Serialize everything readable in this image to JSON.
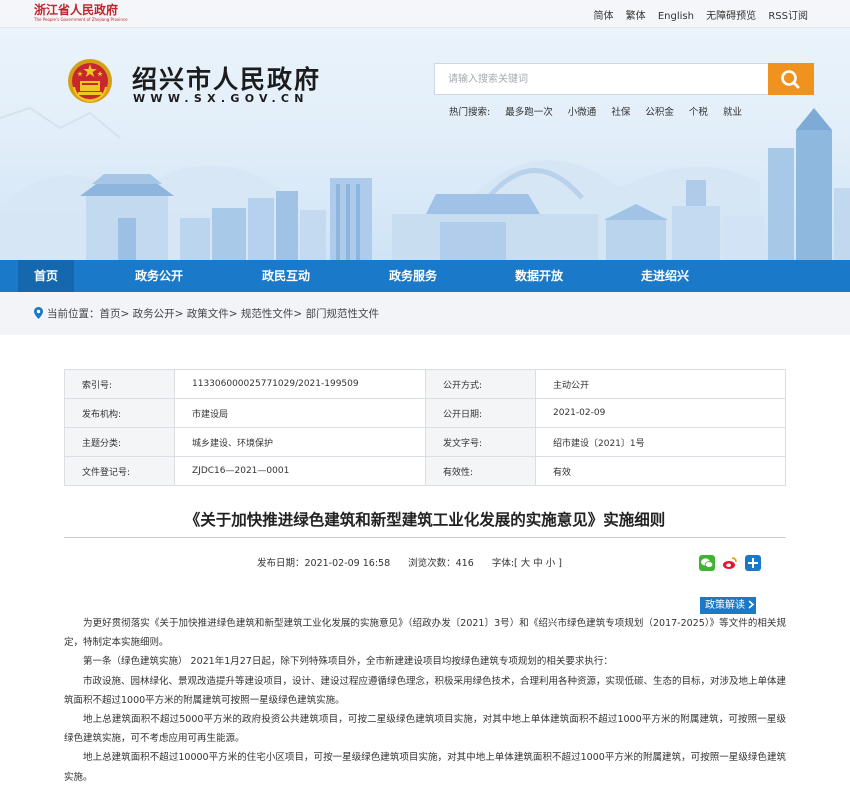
{
  "topbar": {
    "province_cn": "浙江省人民政府",
    "province_en": "The People's Government of Zhejiang Province",
    "links": [
      "简体",
      "繁体",
      "English",
      "无障碍预览",
      "RSS订阅"
    ]
  },
  "header": {
    "site_name": "绍兴市人民政府",
    "site_url": "WWW.SX.GOV.CN",
    "search_placeholder": "请输入搜索关键词",
    "hot_label": "热门搜索:",
    "hot_terms": [
      "最多跑一次",
      "小微通",
      "社保",
      "公积金",
      "个税",
      "就业"
    ]
  },
  "nav": [
    "首页",
    "政务公开",
    "政民互动",
    "政务服务",
    "数据开放",
    "走进绍兴"
  ],
  "breadcrumb": {
    "label": "当前位置：",
    "items": [
      "首页",
      "政务公开",
      "政策文件",
      "规范性文件",
      "部门规范性文件"
    ]
  },
  "info_table": [
    [
      "索引号:",
      "113306000025771029/2021-199509",
      "公开方式:",
      "主动公开"
    ],
    [
      "发布机构:",
      "市建设局",
      "公开日期:",
      "2021-02-09"
    ],
    [
      "主题分类:",
      "城乡建设、环境保护",
      "发文字号:",
      "绍市建设〔2021〕1号"
    ],
    [
      "文件登记号:",
      "ZJDC16—2021—0001",
      "有效性:",
      "有效"
    ]
  ],
  "doc": {
    "title": "《关于加快推进绿色建筑和新型建筑工业化发展的实施意见》实施细则",
    "publish_date": "发布日期：2021-02-09 16:58",
    "views": "浏览次数：416",
    "font_size": "字体:[ 大 中 小 ]",
    "interpretation": "政策解读",
    "paragraphs": [
      "为更好贯彻落实《关于加快推进绿色建筑和新型建筑工业化发展的实施意见》（绍政办发〔2021〕3号）和《绍兴市绿色建筑专项规划（2017-2025）》等文件的相关规定，特制定本实施细则。",
      "第一条（绿色建筑实施） 2021年1月27日起，除下列特殊项目外，全市新建建设项目均按绿色建筑专项规划的相关要求执行：",
      "市政设施、园林绿化、景观改造提升等建设项目，设计、建设过程应遵循绿色理念，积极采用绿色技术，合理利用各种资源，实现低碳、生态的目标，对涉及地上单体建筑面积不超过1000平方米的附属建筑可按照一星级绿色建筑实施。",
      "地上总建筑面积不超过5000平方米的政府投资公共建筑项目，可按二星级绿色建筑项目实施，对其中地上单体建筑面积不超过1000平方米的附属建筑，可按照一星级绿色建筑实施，可不考虑应用可再生能源。",
      "地上总建筑面积不超过10000平方米的住宅小区项目，可按一星级绿色建筑项目实施，对其中地上单体建筑面积不超过1000平方米的附属建筑，可按照一星级绿色建筑实施。"
    ]
  },
  "colors": {
    "nav_blue": "#1a79c8",
    "nav_active": "#1567ae",
    "search_orange": "#f0931e",
    "province_red": "#c2242a"
  },
  "icons": [
    "emblem",
    "search-icon",
    "location-pin-icon",
    "wechat-icon",
    "weibo-icon",
    "share-plus-icon",
    "chevron-right-icon"
  ]
}
